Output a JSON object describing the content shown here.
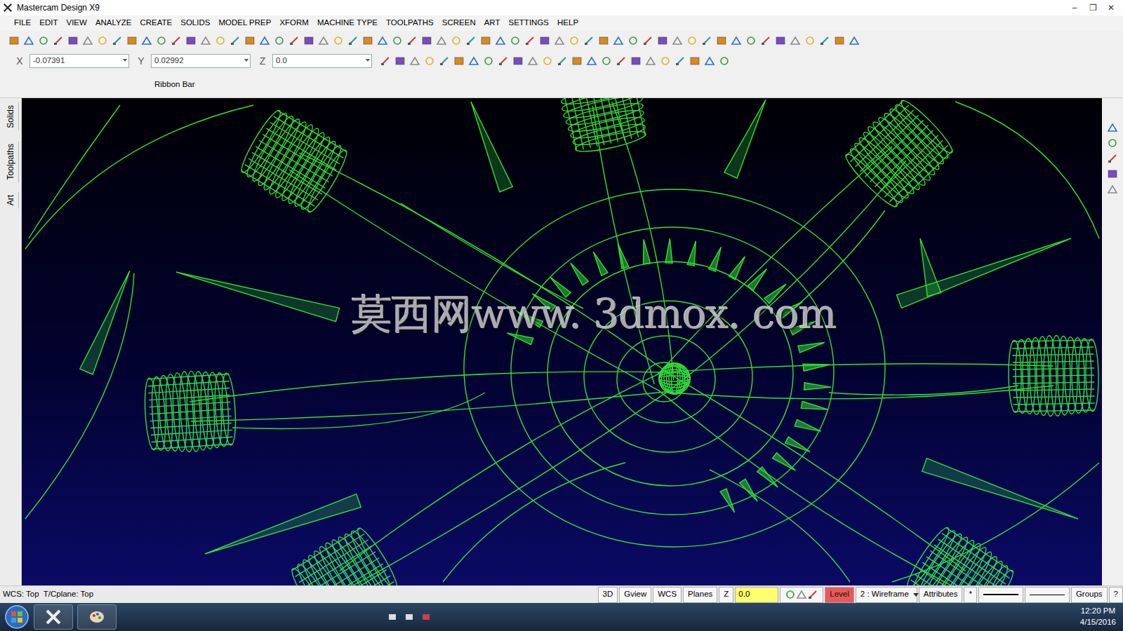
{
  "window": {
    "title": "Mastercam Design X9",
    "controls": [
      "–",
      "❐",
      "✕"
    ]
  },
  "menu": [
    "FILE",
    "EDIT",
    "VIEW",
    "ANALYZE",
    "CREATE",
    "SOLIDS",
    "MODEL PREP",
    "XFORM",
    "MACHINE TYPE",
    "TOOLPATHS",
    "SCREEN",
    "ART",
    "SETTINGS",
    "HELP"
  ],
  "coordinates": [
    {
      "label": "X",
      "value": "-0.07391"
    },
    {
      "label": "Y",
      "value": "0.02992"
    },
    {
      "label": "Z",
      "value": "0.0"
    }
  ],
  "ribbon_bar": {
    "label": "Ribbon Bar"
  },
  "side_tabs": [
    "Solids",
    "Toolpaths",
    "Art"
  ],
  "viewport": {
    "watermark": "莫西网www. 3dmox. com"
  },
  "status_bar": {
    "planes": "WCS: Top  T/Cplane: Top",
    "buttons": [
      "3D",
      "Gview",
      "WCS",
      "Planes"
    ],
    "z_label": "Z",
    "z_value": "0.0",
    "level_label": "Level",
    "level_value": "2 : Wireframe",
    "attributes": "Attributes",
    "line_style": "*",
    "groups": "Groups",
    "help": "?"
  },
  "taskbar": {
    "time": "12:20 PM",
    "date": "4/15/2016"
  }
}
